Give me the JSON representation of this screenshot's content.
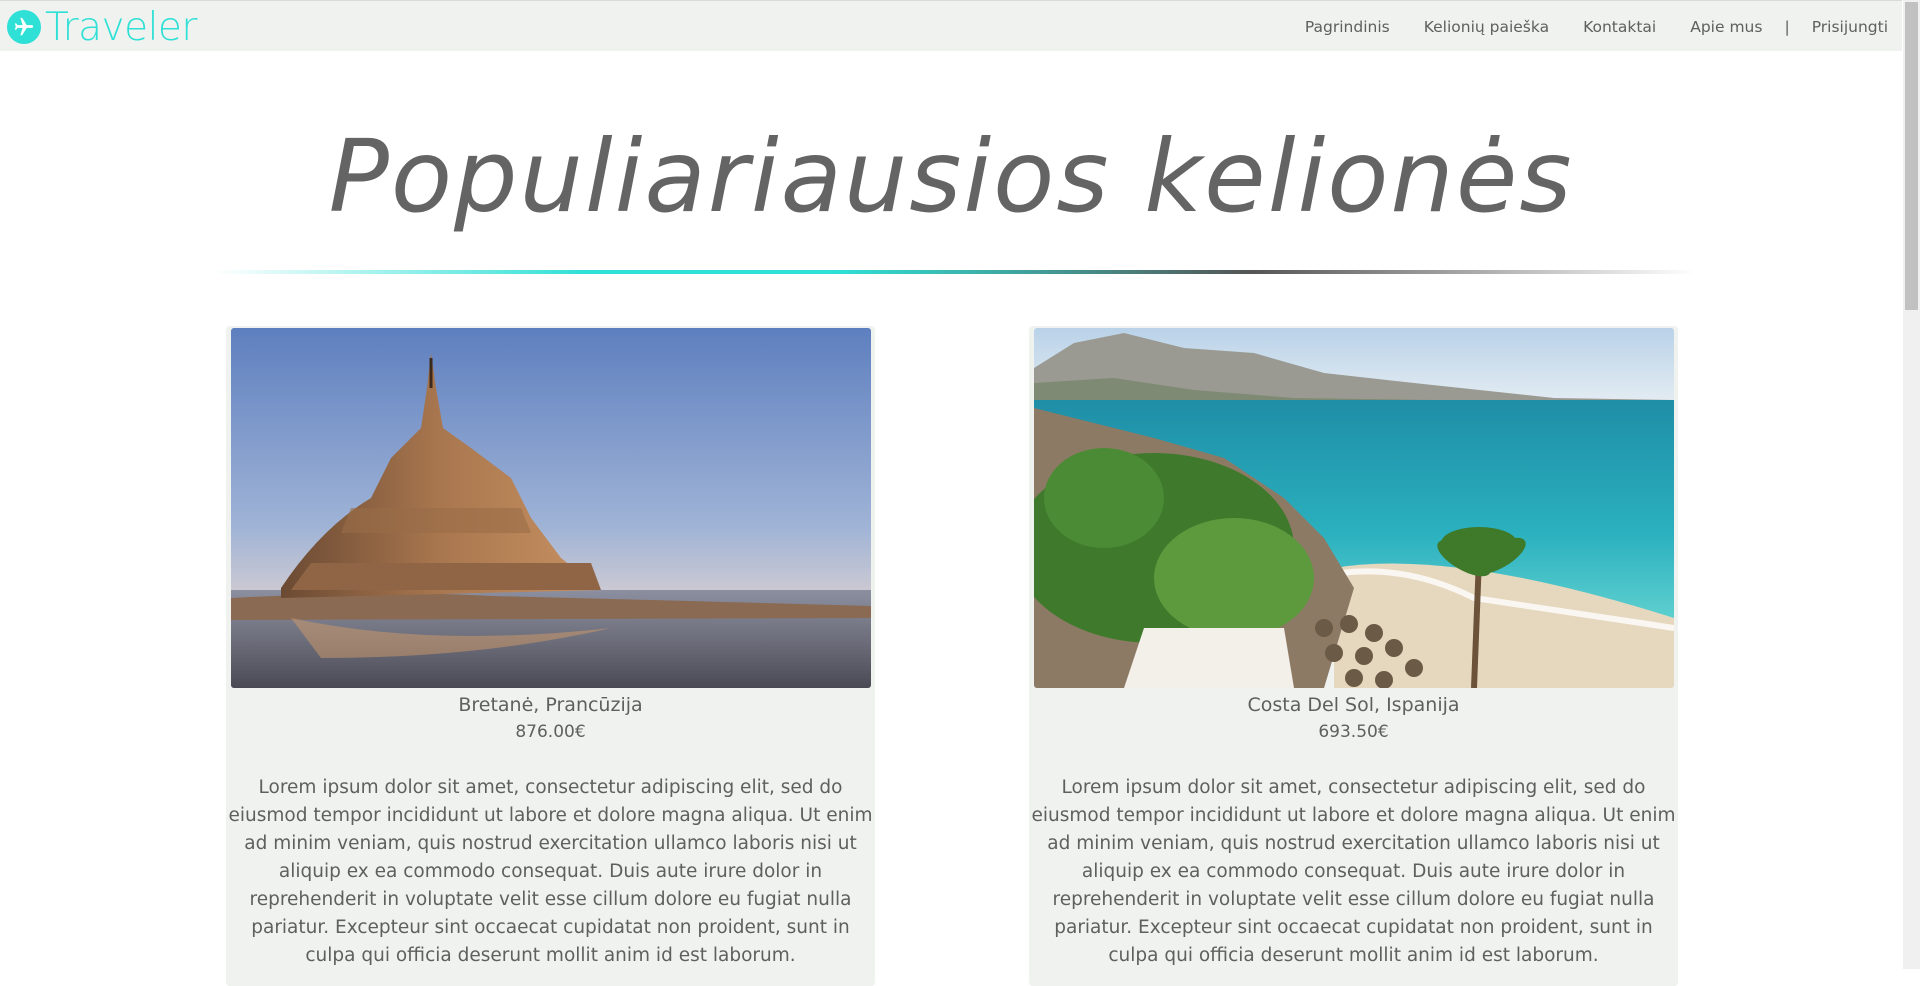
{
  "brand": {
    "name": "Traveler",
    "accent": "#2fe0d6"
  },
  "nav": {
    "links": [
      "Pagrindinis",
      "Kelionių paieška",
      "Kontaktai",
      "Apie mus"
    ],
    "separator": "|",
    "login": "Prisijungti"
  },
  "hero": {
    "title": "Populiariausios kelionės"
  },
  "cards": [
    {
      "destination": "Bretanė, Prancūzija",
      "price": "876.00€",
      "description": "Lorem ipsum dolor sit amet, consectetur adipiscing elit, sed do eiusmod tempor incididunt ut labore et dolore magna aliqua. Ut enim ad minim veniam, quis nostrud exercitation ullamco laboris nisi ut aliquip ex ea commodo consequat. Duis aute irure dolor in reprehenderit in voluptate velit esse cillum dolore eu fugiat nulla pariatur. Excepteur sint occaecat cupidatat non proident, sunt in culpa qui officia deserunt mollit anim id est laborum."
    },
    {
      "destination": "Costa Del Sol, Ispanija",
      "price": "693.50€",
      "description": "Lorem ipsum dolor sit amet, consectetur adipiscing elit, sed do eiusmod tempor incididunt ut labore et dolore magna aliqua. Ut enim ad minim veniam, quis nostrud exercitation ullamco laboris nisi ut aliquip ex ea commodo consequat. Duis aute irure dolor in reprehenderit in voluptate velit esse cillum dolore eu fugiat nulla pariatur. Excepteur sint occaecat cupidatat non proident, sunt in culpa qui officia deserunt mollit anim id est laborum."
    }
  ]
}
